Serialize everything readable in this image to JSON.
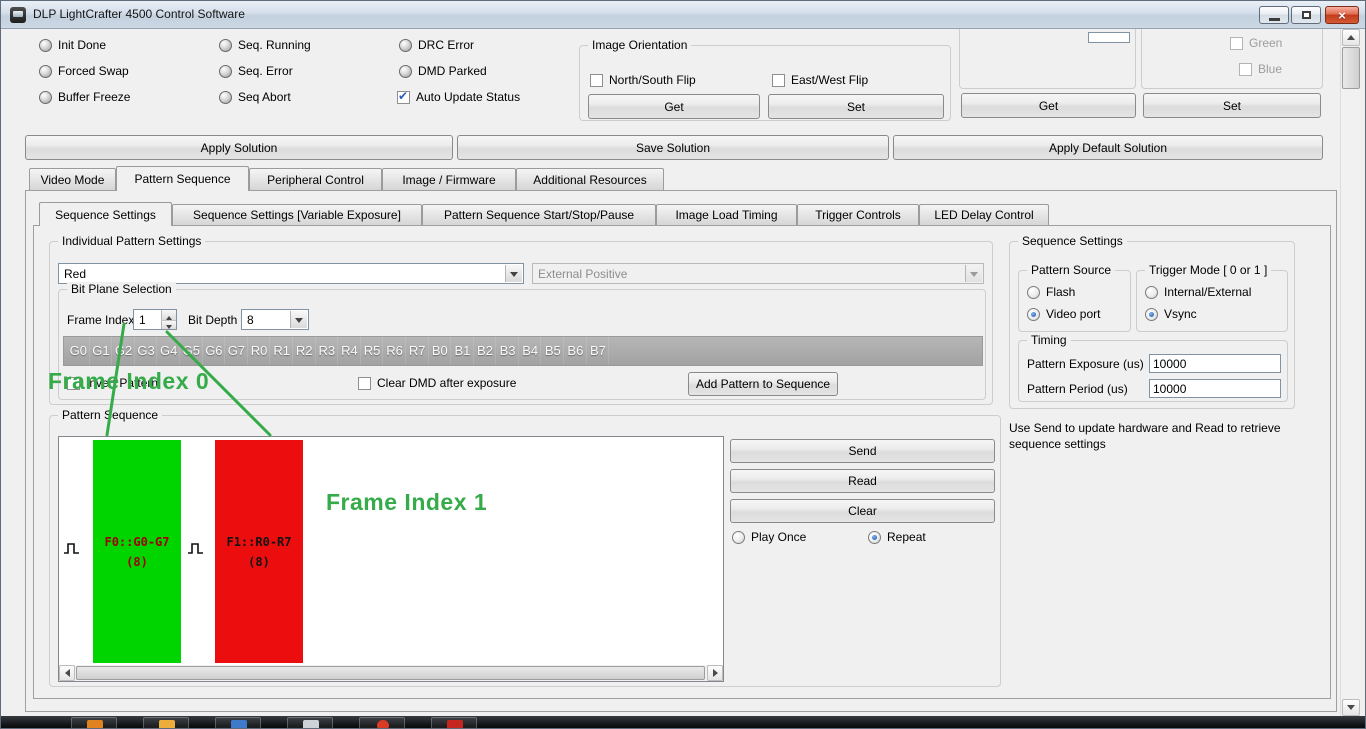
{
  "titlebar": {
    "title": "DLP LightCrafter 4500 Control Software"
  },
  "status_panel": {
    "leds": [
      "Init Done",
      "Forced Swap",
      "Buffer Freeze",
      "Seq. Running",
      "Seq. Error",
      "Seq Abort",
      "DRC Error",
      "DMD Parked"
    ],
    "auto_update_label": "Auto Update Status"
  },
  "image_orientation": {
    "title": "Image Orientation",
    "north_south_label": "North/South Flip",
    "east_west_label": "East/West Flip",
    "get_button": "Get",
    "set_button": "Set"
  },
  "led_control": {
    "get_button": "Get",
    "set_button": "Set",
    "green_label": "Green",
    "blue_label": "Blue"
  },
  "solution_bar": {
    "apply_button": "Apply Solution",
    "save_button": "Save Solution",
    "apply_default_button": "Apply Default Solution"
  },
  "main_tabs": {
    "items": [
      "Video Mode",
      "Pattern Sequence",
      "Peripheral Control",
      "Image / Firmware",
      "Additional Resources"
    ],
    "selected": "Pattern Sequence"
  },
  "sub_tabs": {
    "items": [
      "Sequence Settings",
      "Sequence Settings [Variable Exposure]",
      "Pattern Sequence Start/Stop/Pause",
      "Image Load Timing",
      "Trigger Controls",
      "LED Delay Control"
    ],
    "selected": "Sequence Settings"
  },
  "individual_pattern_settings": {
    "title": "Individual Pattern Settings",
    "color_selected": "Red",
    "trigger_selected": "External Positive",
    "bit_plane_selection": {
      "title": "Bit Plane Selection",
      "frame_index_label": "Frame Index",
      "frame_index_value": "1",
      "bit_depth_label": "Bit Depth",
      "bit_depth_value": "8",
      "planes": [
        "G0",
        "G1",
        "G2",
        "G3",
        "G4",
        "G5",
        "G6",
        "G7",
        "R0",
        "R1",
        "R2",
        "R3",
        "R4",
        "R5",
        "R6",
        "R7",
        "B0",
        "B1",
        "B2",
        "B3",
        "B4",
        "B5",
        "B6",
        "B7"
      ]
    },
    "invert_pattern_label": "Invert Pattern",
    "clear_dmd_label": "Clear DMD after exposure",
    "add_pattern_button": "Add Pattern to Sequence"
  },
  "pattern_sequence": {
    "title": "Pattern Sequence",
    "patterns": [
      {
        "label": "F0::G0-G7",
        "bit_depth": "(8)",
        "color": "#00d500",
        "text_color": "#a00000"
      },
      {
        "label": "F1::R0-R7",
        "bit_depth": "(8)",
        "color": "#ec0e0e",
        "text_color": "#141414"
      }
    ],
    "send_button": "Send",
    "read_button": "Read",
    "clear_button": "Clear",
    "play_once_label": "Play Once",
    "repeat_label": "Repeat",
    "play_mode_selected": "Repeat"
  },
  "sequence_settings": {
    "title": "Sequence Settings",
    "pattern_source": {
      "title": "Pattern Source",
      "options": [
        "Flash",
        "Video port"
      ],
      "selected": "Video port"
    },
    "trigger_mode": {
      "title": "Trigger Mode [ 0 or 1 ]",
      "options": [
        "Internal/External",
        "Vsync"
      ],
      "selected": "Vsync"
    },
    "timing": {
      "title": "Timing",
      "exposure_label": "Pattern Exposure (us)",
      "exposure_value": "10000",
      "period_label": "Pattern Period (us)",
      "period_value": "10000"
    },
    "note": "Use Send to update hardware and Read to retrieve sequence settings"
  },
  "annotations": {
    "frame_index_0": "Frame Index 0",
    "frame_index_1": "Frame Index 1",
    "color": "#35ab49"
  }
}
